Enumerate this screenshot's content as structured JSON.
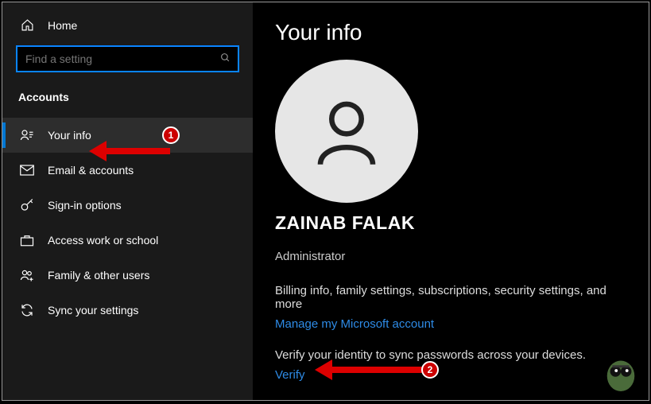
{
  "sidebar": {
    "home_label": "Home",
    "search_placeholder": "Find a setting",
    "section_label": "Accounts",
    "items": [
      {
        "label": "Your info",
        "icon": "person-lines",
        "selected": true
      },
      {
        "label": "Email & accounts",
        "icon": "envelope",
        "selected": false
      },
      {
        "label": "Sign-in options",
        "icon": "key",
        "selected": false
      },
      {
        "label": "Access work or school",
        "icon": "briefcase",
        "selected": false
      },
      {
        "label": "Family & other users",
        "icon": "people-plus",
        "selected": false
      },
      {
        "label": "Sync your settings",
        "icon": "sync",
        "selected": false
      }
    ]
  },
  "main": {
    "title": "Your info",
    "display_name": "ZAINAB FALAK",
    "role": "Administrator",
    "billing_desc": "Billing info, family settings, subscriptions, security settings, and more",
    "manage_link": "Manage my Microsoft account",
    "verify_desc": "Verify your identity to sync passwords across your devices.",
    "verify_link": "Verify"
  },
  "annotations": {
    "step1": "1",
    "step2": "2"
  }
}
